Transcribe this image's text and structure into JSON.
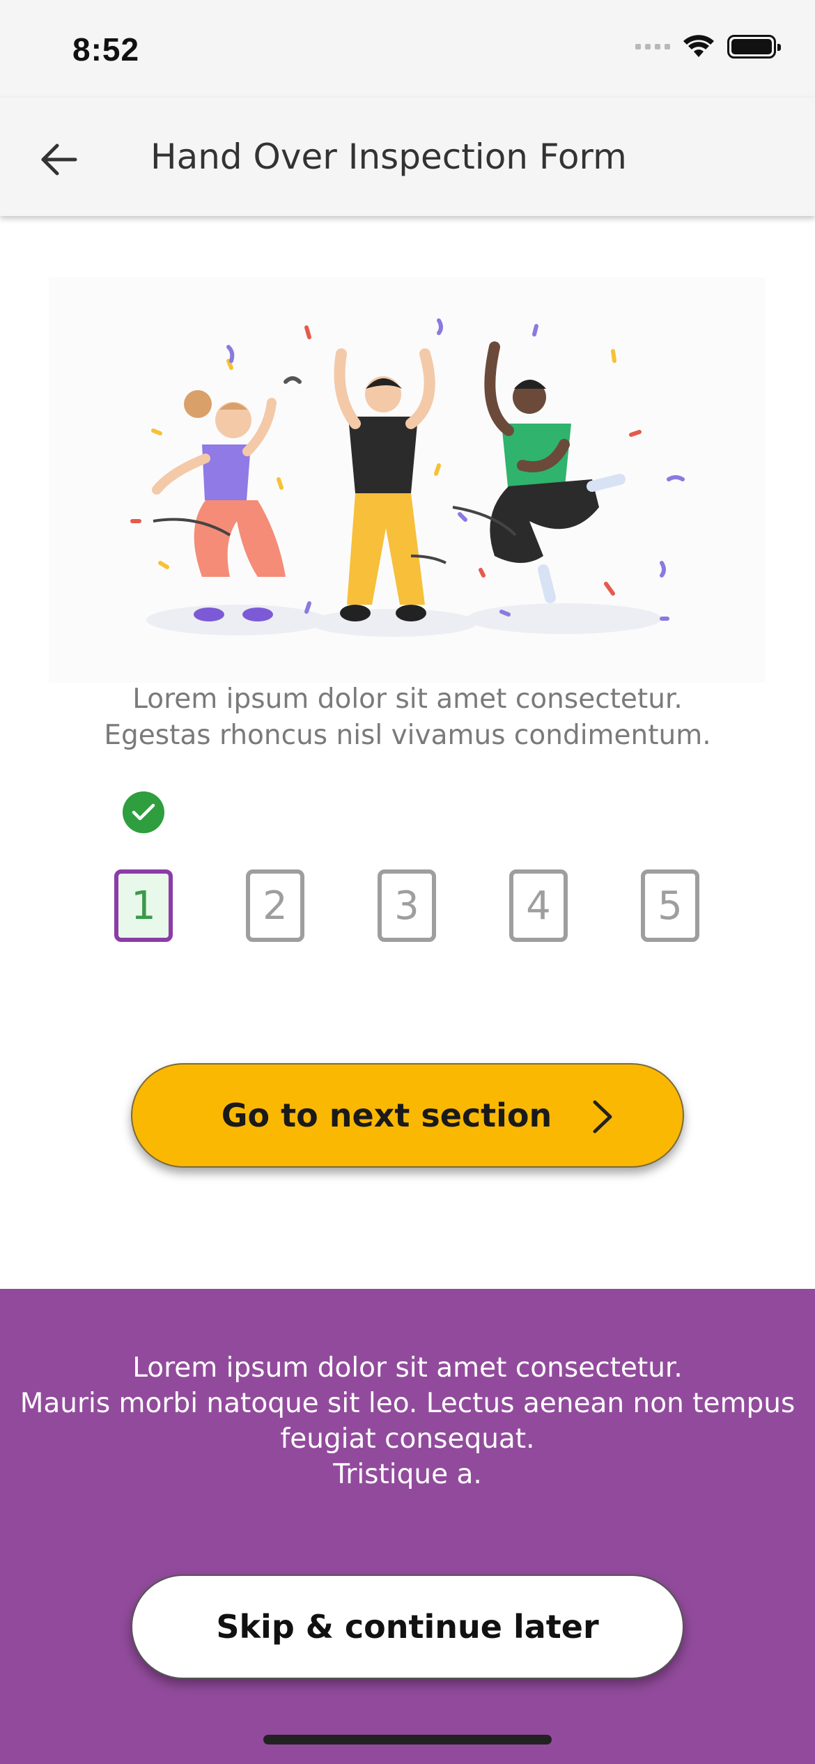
{
  "status_bar": {
    "time": "8:52",
    "icons": [
      "signal-icon",
      "wifi-icon",
      "battery-icon"
    ]
  },
  "app_bar": {
    "back_icon": "arrow-left-icon",
    "title": "Hand Over Inspection Form"
  },
  "illustration": {
    "description_icon": "celebration-illustration"
  },
  "intro": {
    "line1": "Lorem ipsum dolor sit amet consectetur.",
    "line2": "Egestas rhoncus nisl vivamus condimentum."
  },
  "progress": {
    "completed_icon": "check-circle-icon",
    "steps": [
      "1",
      "2",
      "3",
      "4",
      "5"
    ],
    "active_step": 1
  },
  "next_button": {
    "label": "Go to next section",
    "icon": "chevron-right-icon"
  },
  "footer": {
    "line1": "Lorem ipsum dolor sit amet consectetur.",
    "line2": "Mauris morbi natoque sit leo. Lectus aenean non tempus",
    "line3": "feugiat consequat.",
    "line4": "Tristique a.",
    "skip_label": "Skip & continue later"
  },
  "colors": {
    "accent_yellow": "#fbb803",
    "footer_purple": "#924b9c",
    "active_step_border": "#8b3ca6",
    "check_green": "#2e9e3f",
    "app_bar_bg": "#f5f5f5"
  }
}
